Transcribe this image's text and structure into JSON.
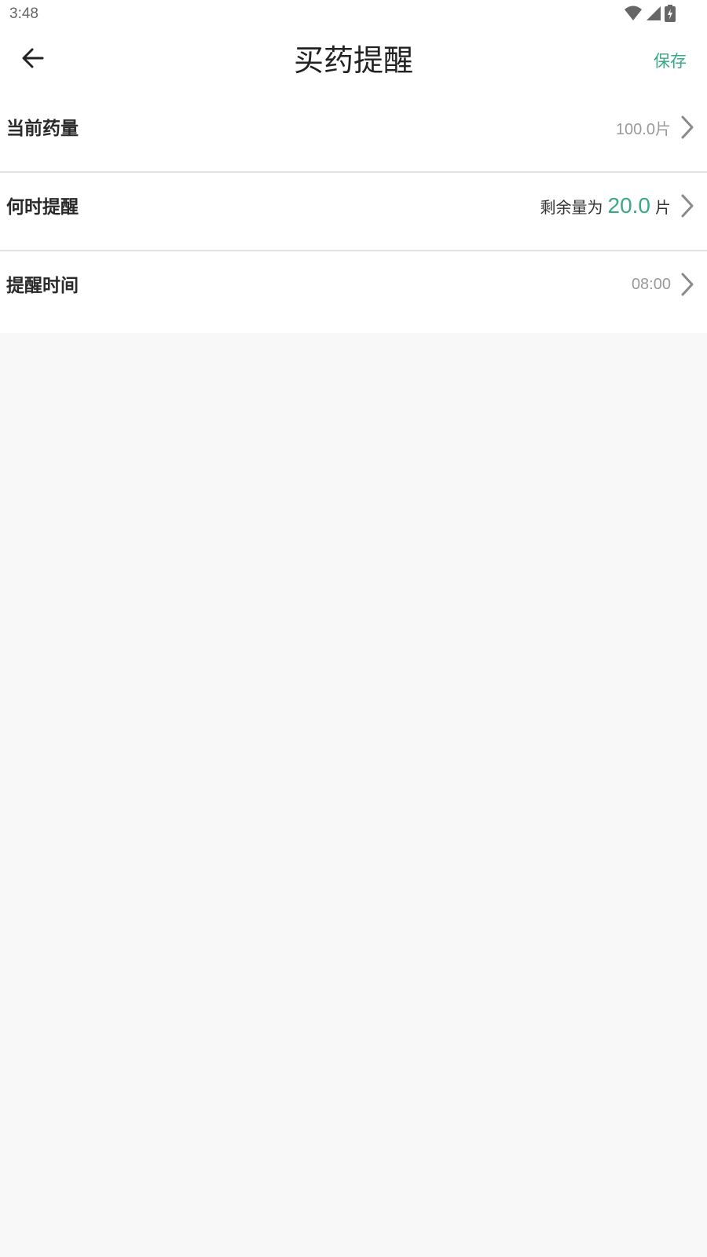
{
  "status_bar": {
    "time": "3:48",
    "icons": [
      "wifi-icon",
      "cell-signal-icon",
      "battery-charging-icon"
    ]
  },
  "app_bar": {
    "title": "买药提醒",
    "save_label": "保存",
    "back_icon": "arrow-left-icon"
  },
  "colors": {
    "accent": "#3aa985",
    "background": "#f8f8f8",
    "surface": "#ffffff",
    "divider": "#e2e2e2"
  },
  "settings": {
    "current_amount": {
      "label": "当前药量",
      "value": "100.0片"
    },
    "remind_when": {
      "label": "何时提醒",
      "prefix": "剩余量为",
      "value": "20.0",
      "unit": "片"
    },
    "remind_time": {
      "label": "提醒时间",
      "value": "08:00"
    }
  }
}
